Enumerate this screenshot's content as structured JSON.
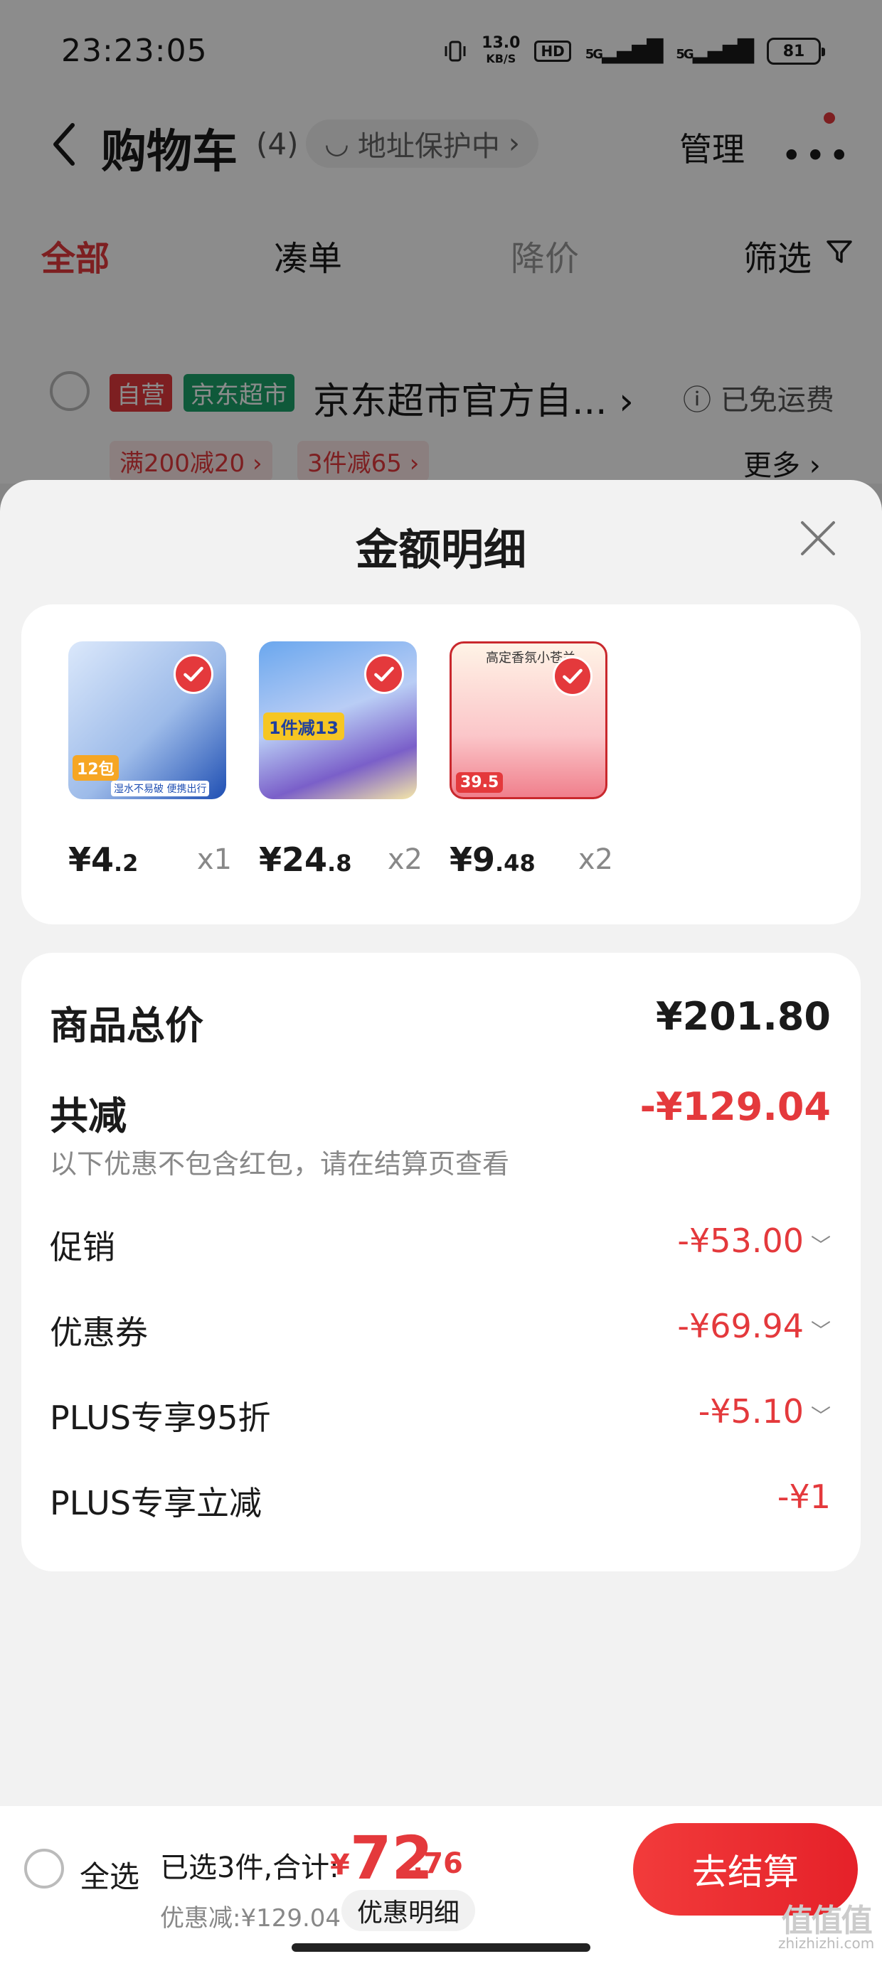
{
  "status_bar": {
    "time": "23:23:05",
    "net_speed_value": "13.0",
    "net_speed_unit": "KB/S",
    "hd": "HD",
    "sig1": "5G",
    "sig2": "5G",
    "battery": "81"
  },
  "nav": {
    "title": "购物车",
    "count": "(4)",
    "address_protection": "地址保护中",
    "manage": "管理"
  },
  "filters": {
    "all": "全部",
    "bundle": "凑单",
    "price_drop": "降价",
    "filter": "筛选"
  },
  "store": {
    "tag_self": "自营",
    "tag_market": "京东超市",
    "name": "京东超市官方自...",
    "shipping": "已免运费",
    "promo_1": "满200减20",
    "promo_2": "3件减65",
    "more": "更多"
  },
  "sheet": {
    "title": "金额明细",
    "products": [
      {
        "img_badge": "12包",
        "img_text": "湿水不易破 便携出行",
        "price_int": "¥4",
        "price_dec": ".2",
        "qty": "x1"
      },
      {
        "img_badge": "1件减13",
        "img_text": "",
        "price_int": "¥24",
        "price_dec": ".8",
        "qty": "x2"
      },
      {
        "img_badge": "39.5",
        "img_text": "高定香氛小苍兰",
        "price_int": "¥9",
        "price_dec": ".48",
        "qty": "x2"
      }
    ],
    "summary": {
      "total_label": "商品总价",
      "total_value": "¥201.80",
      "reduce_label": "共减",
      "reduce_value": "-¥129.04",
      "reduce_hint": "以下优惠不包含红包，请在结算页查看",
      "rows": [
        {
          "label": "促销",
          "value": "-¥53.00"
        },
        {
          "label": "优惠券",
          "value": "-¥69.94"
        },
        {
          "label": "PLUS专享95折",
          "value": "-¥5.10"
        },
        {
          "label": "PLUS专享立减",
          "value": "-¥1"
        }
      ]
    }
  },
  "bottom_bar": {
    "select_all": "全选",
    "selected_text": "已选3件,合计:",
    "total_symbol": "¥",
    "total_int": "72",
    "total_dec": ".76",
    "discount_text": "优惠减:¥129.04",
    "detail_chip": "优惠明细",
    "checkout": "去结算"
  },
  "colors": {
    "accent": "#e4393c",
    "market_green": "#1ca36a",
    "sheet_bg": "#f2f2f2"
  },
  "watermark": {
    "logo": "值值值",
    "domain": "zhizhizhi.com"
  }
}
